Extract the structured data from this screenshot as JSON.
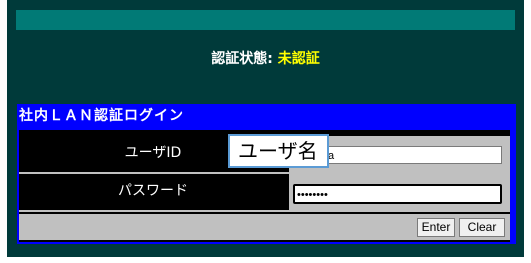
{
  "status": {
    "label": "認証状態:",
    "value": "未認証"
  },
  "login": {
    "title": "社内ＬＡＮ認証ログイン",
    "user_label": "ユーザID",
    "user_value": "@alpha",
    "username_overlay": "ユーザ名",
    "password_label": "パスワード",
    "password_value": "••••••••",
    "enter_label": "Enter",
    "clear_label": "Clear"
  }
}
